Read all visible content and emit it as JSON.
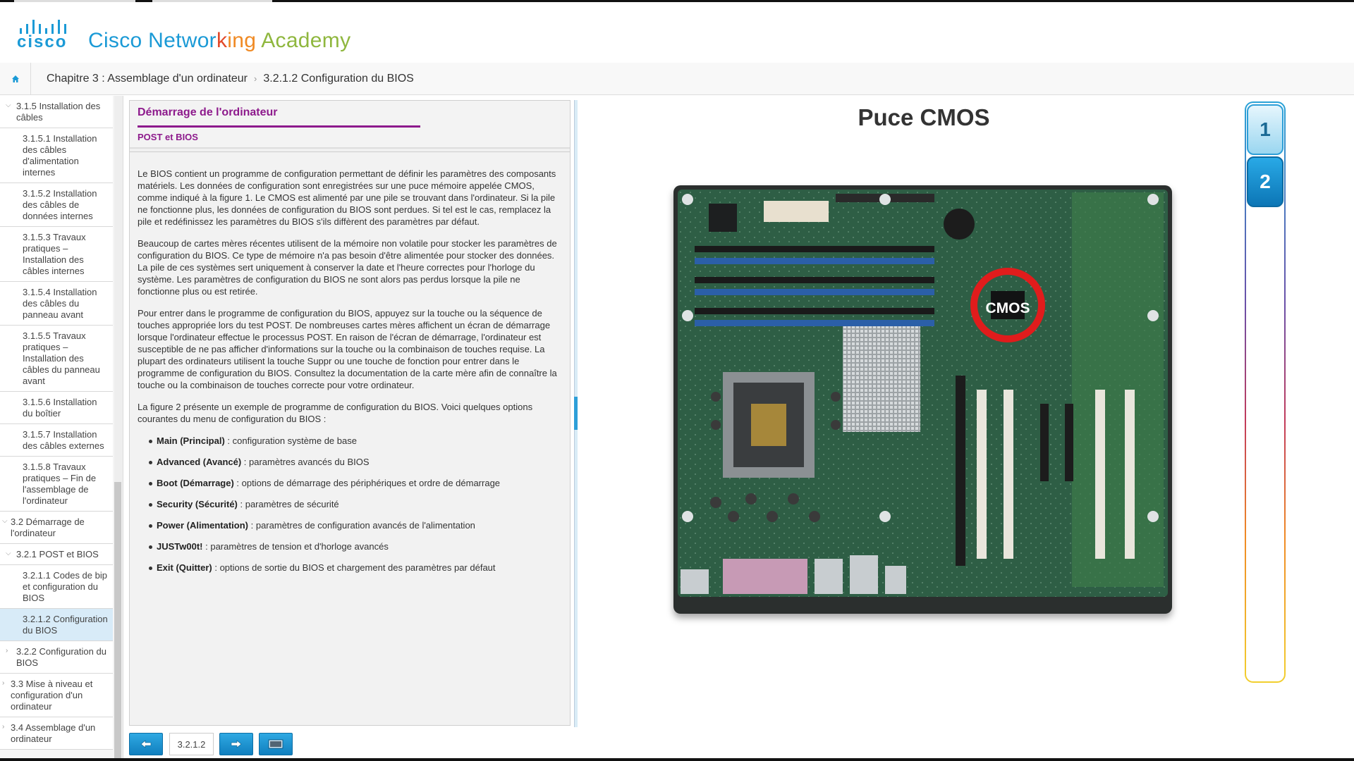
{
  "header": {
    "logo_word": "cisco",
    "academy_parts": [
      "Cisco Networ",
      "k",
      "ing",
      " Academy"
    ]
  },
  "breadcrumb": {
    "chapter": "Chapitre 3 : Assemblage d'un ordinateur",
    "page": "3.2.1.2 Configuration du BIOS"
  },
  "sidebar": {
    "items": [
      {
        "label": "3.1.5 Installation des câbles",
        "level": 2,
        "chevron": "down"
      },
      {
        "label": "3.1.5.1 Installation des câbles d'alimentation internes",
        "level": 3
      },
      {
        "label": "3.1.5.2 Installation des câbles de données internes",
        "level": 3
      },
      {
        "label": "3.1.5.3 Travaux pratiques – Installation des câbles internes",
        "level": 3
      },
      {
        "label": "3.1.5.4 Installation des câbles du panneau avant",
        "level": 3
      },
      {
        "label": "3.1.5.5 Travaux pratiques – Installation des câbles du panneau avant",
        "level": 3
      },
      {
        "label": "3.1.5.6 Installation du boîtier",
        "level": 3
      },
      {
        "label": "3.1.5.7 Installation des câbles externes",
        "level": 3
      },
      {
        "label": "3.1.5.8 Travaux pratiques – Fin de l'assemblage de l'ordinateur",
        "level": 3
      },
      {
        "label": "3.2 Démarrage de l'ordinateur",
        "level": 1,
        "chevron": "down"
      },
      {
        "label": "3.2.1 POST et BIOS",
        "level": 2,
        "chevron": "down"
      },
      {
        "label": "3.2.1.1 Codes de bip et configuration du BIOS",
        "level": 3
      },
      {
        "label": "3.2.1.2 Configuration du BIOS",
        "level": 3,
        "active": true
      },
      {
        "label": "3.2.2 Configuration du BIOS",
        "level": 2,
        "chevron": "right"
      },
      {
        "label": "3.3 Mise à niveau et configuration d'un ordinateur",
        "level": 1,
        "chevron": "right"
      },
      {
        "label": "3.4 Assemblage d'un ordinateur",
        "level": 1,
        "chevron": "right"
      }
    ]
  },
  "content": {
    "title": "Démarrage de l'ordinateur",
    "subtitle": "POST et BIOS",
    "paragraphs": [
      "Le BIOS contient un programme de configuration permettant de définir les paramètres des composants matériels. Les données de configuration sont enregistrées sur une puce mémoire appelée CMOS, comme indiqué à la figure 1. Le CMOS est alimenté par une pile se trouvant dans l'ordinateur. Si la pile ne fonctionne plus, les données de configuration du BIOS sont perdues. Si tel est le cas, remplacez la pile et redéfinissez les paramètres du BIOS s'ils diffèrent des paramètres par défaut.",
      "Beaucoup de cartes mères récentes utilisent de la mémoire non volatile pour stocker les paramètres de configuration du BIOS. Ce type de mémoire n'a pas besoin d'être alimentée pour stocker des données. La pile de ces systèmes sert uniquement à conserver la date et l'heure correctes pour l'horloge du système. Les paramètres de configuration du BIOS ne sont alors pas perdus lorsque la pile ne fonctionne plus ou est retirée.",
      "Pour entrer dans le programme de configuration du BIOS, appuyez sur la touche ou la séquence de touches appropriée lors du test POST. De nombreuses cartes mères affichent un écran de démarrage lorsque l'ordinateur effectue le processus POST. En raison de l'écran de démarrage, l'ordinateur est susceptible de ne pas afficher d'informations sur la touche ou la combinaison de touches requise. La plupart des ordinateurs utilisent la touche Suppr ou une touche de fonction pour entrer dans le programme de configuration du BIOS. Consultez la documentation de la carte mère afin de connaître la touche ou la combinaison de touches correcte pour votre ordinateur.",
      "La figure 2 présente un exemple de programme de configuration du BIOS. Voici quelques options courantes du menu de configuration du BIOS :"
    ],
    "options": [
      {
        "term": "Main (Principal)",
        "desc": " : configuration système de base"
      },
      {
        "term": "Advanced (Avancé)",
        "desc": " : paramètres avancés du BIOS"
      },
      {
        "term": "Boot (Démarrage)",
        "desc": " : options de démarrage des périphériques et ordre de démarrage"
      },
      {
        "term": "Security (Sécurité)",
        "desc": " : paramètres de sécurité"
      },
      {
        "term": "Power (Alimentation)",
        "desc": " : paramètres de configuration avancés de l'alimentation"
      },
      {
        "term": "JUSTw00t!",
        "desc": " : paramètres de tension et d'horloge avancés"
      },
      {
        "term": "Exit (Quitter)",
        "desc": " : options de sortie du BIOS et chargement des paramètres par défaut"
      }
    ]
  },
  "navigation": {
    "page_number": "3.2.1.2"
  },
  "media": {
    "title": "Puce CMOS",
    "callout": "CMOS",
    "figure_tabs": [
      "1",
      "2"
    ],
    "active_figure": "2"
  },
  "colors": {
    "brand_blue": "#1b9ad6",
    "content_purple": "#8d1a8c",
    "active_nav": "#d8ebf8"
  }
}
